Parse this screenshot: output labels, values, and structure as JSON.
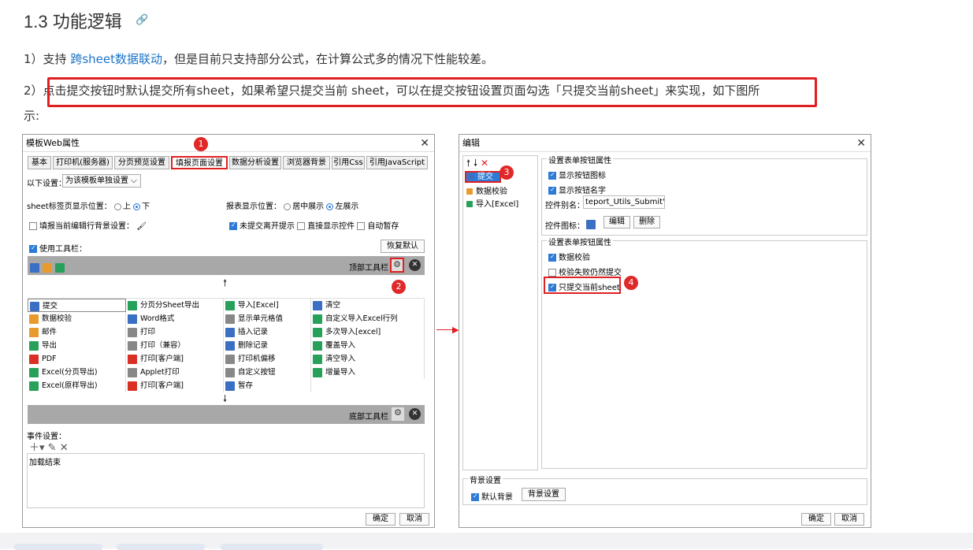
{
  "heading": "1.3 功能逻辑",
  "anchor_icon": "link-icon",
  "para1": {
    "prefix": "1）支持 ",
    "link": "跨sheet数据联动",
    "suffix": "，但是目前只支持部分公式，在计算公式多的情况下性能较差。"
  },
  "para2": {
    "prefix": "2）",
    "highlight": "点击提交按钮时默认提交所有sheet，如果希望只提交当前 sheet，可以在提交按钮设置页面勾选「只提交当前sheet」来实现，",
    "suffix": "如下图所",
    "line2": "示:"
  },
  "left_dialog": {
    "title": "模板Web属性",
    "tabs": [
      "基本",
      "打印机(服务器)",
      "分页预览设置",
      "填报页面设置",
      "数据分析设置",
      "浏览器背景",
      "引用Css",
      "引用JavaScript"
    ],
    "settings_label": "以下设置：",
    "settings_value": "为该模板单独设置",
    "sheet_pos_label": "sheet标签页显示位置：",
    "opt_top": "上",
    "opt_bottom": "下",
    "report_pos_label": "报表显示位置：",
    "opt_center": "居中展示",
    "opt_left": "左展示",
    "fill_bg_label": "填报当前编辑行背景设置：",
    "unsubmitted_label": "未提交离开提示",
    "direct_show_label": "直接显示控件",
    "auto_save_label": "自动暂存",
    "use_toolbar_label": "使用工具栏：",
    "restore_default": "恢复默认",
    "top_toolbar": "顶部工具栏",
    "bottom_toolbar": "底部工具栏",
    "col1": [
      "提交",
      "数据校验",
      "邮件",
      "导出",
      "PDF",
      "Excel(分页导出)",
      "Excel(原样导出)"
    ],
    "col2": [
      "分页分Sheet导出",
      "Word格式",
      "打印",
      "打印（兼容）",
      "打印[客户端]",
      "Applet打印",
      "打印[客户端]"
    ],
    "col3": [
      "导入[Excel]",
      "显示单元格值",
      "插入记录",
      "删除记录",
      "打印机偏移",
      "自定义按钮",
      "暂存"
    ],
    "col4": [
      "清空",
      "自定义导入Excel行列",
      "多次导入[excel]",
      "覆盖导入",
      "清空导入",
      "增量导入"
    ],
    "event_label": "事件设置：",
    "event_item": "加载结束",
    "ok": "确定",
    "cancel": "取消"
  },
  "right_dialog": {
    "title": "编辑",
    "tree": [
      "提交",
      "数据校验",
      "导入[Excel]"
    ],
    "single_group": "设置表单按钮属性",
    "show_icon": "显示按钮图标",
    "show_name": "显示按钮名字",
    "alias_label": "控件别名：",
    "alias_value": "teport_Utils_Submit')}",
    "icon_label": "控件图标：",
    "edit_btn": "编辑",
    "delete_btn": "删除",
    "form_group": "设置表单按钮属性",
    "data_verify": "数据校验",
    "fail_submit": "校验失败仍然提交",
    "only_current": "只提交当前sheet",
    "bg_group": "背景设置",
    "default_bg": "默认背景",
    "bg_settings": "背景设置",
    "ok": "确定",
    "cancel": "取消"
  },
  "markers": [
    "1",
    "2",
    "3",
    "4"
  ],
  "colors": {
    "accent": "#e02020",
    "link": "#1a73c8",
    "selected": "#2d7bd6"
  }
}
